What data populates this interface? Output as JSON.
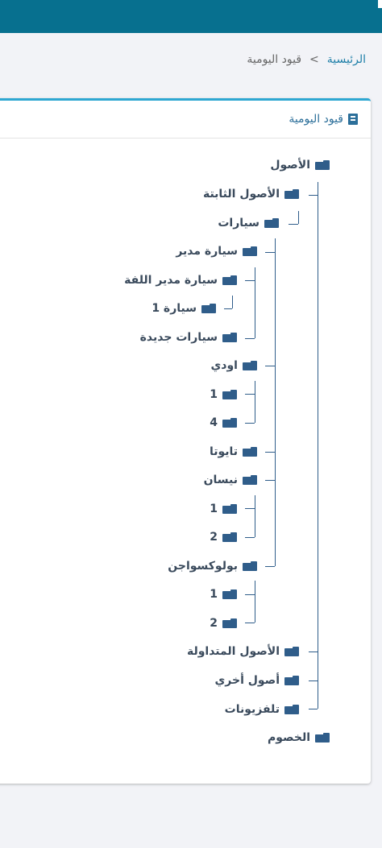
{
  "breadcrumb": {
    "home": "الرئيسية",
    "separator": ">",
    "current": "قيود اليومية"
  },
  "panel": {
    "title": "قيود اليومية",
    "title_icon": "book-icon"
  },
  "tree": {
    "icon": "folder-icon",
    "n1": "الأصول",
    "n2": "الأصول الثابتة",
    "n3": "سيارات",
    "n4": "سيارة مدير",
    "n5": "سيارة مدير اللفة",
    "n6": "سيارة 1",
    "n7": "سيارات جديدة",
    "n8": "اودي",
    "n9": "1",
    "n10": "4",
    "n11": "تايوتا",
    "n12": "نيسان",
    "n13": "1",
    "n14": "2",
    "n15": "بولوكسواجن",
    "n16": "1",
    "n17": "2",
    "n18": "الأصول المتداولة",
    "n19": "أصول أخري",
    "n20": "تلفزيونات",
    "n21": "الخصوم"
  }
}
